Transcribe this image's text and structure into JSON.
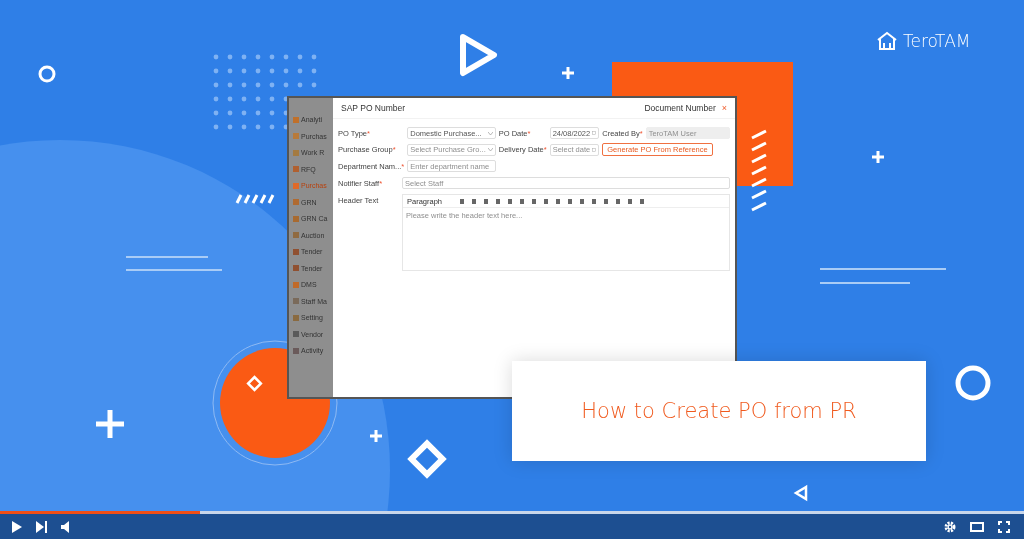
{
  "logo": {
    "name": "TeroTAM"
  },
  "app_window": {
    "title": "SAP PO Number",
    "document_label": "Document Number",
    "close": "×",
    "sidebar": [
      {
        "label": "Analyti",
        "selected": false
      },
      {
        "label": "Purchas",
        "selected": false
      },
      {
        "label": "Work R",
        "selected": false
      },
      {
        "label": "RFQ",
        "selected": false
      },
      {
        "label": "Purchas",
        "selected": true
      },
      {
        "label": "GRN",
        "selected": false
      },
      {
        "label": "GRN Ca",
        "selected": false
      },
      {
        "label": "Auction",
        "selected": false
      },
      {
        "label": "Tender",
        "selected": false
      },
      {
        "label": "Tender",
        "selected": false
      },
      {
        "label": "DMS",
        "selected": false
      },
      {
        "label": "Staff Ma",
        "selected": false
      },
      {
        "label": "Setting",
        "selected": false
      },
      {
        "label": "Vendor",
        "selected": false
      },
      {
        "label": "Activity",
        "selected": false
      }
    ],
    "form_rows": [
      [
        {
          "kind": "select",
          "label": "PO Type",
          "mark": "*",
          "text": "Domestic Purchase...",
          "filled": true,
          "disabled": false
        },
        {
          "kind": "date",
          "label": "PO Date",
          "mark": "*",
          "text": "24/08/2022",
          "filled": true,
          "disabled": false
        },
        {
          "kind": "text",
          "label": "Created By",
          "mark": "*",
          "text": "TeroTAM User",
          "filled": false,
          "disabled": true
        }
      ],
      [
        {
          "kind": "select",
          "label": "Purchase Group",
          "mark": "*",
          "text": "Select Purchase Gro...",
          "filled": false,
          "disabled": false
        },
        {
          "kind": "date",
          "label": "Delivery Date",
          "mark": "*",
          "text": "Select date",
          "filled": false,
          "disabled": false
        },
        {
          "kind": "button",
          "text": "Generate PO From Reference"
        }
      ],
      [
        {
          "kind": "text",
          "label": "Department Nam...",
          "mark": "*",
          "text": "Enter department name",
          "filled": false,
          "disabled": false
        }
      ]
    ],
    "notifier": {
      "label": "Notifier Staff",
      "mark": "*",
      "placeholder": "Select Staff"
    },
    "header_text": {
      "label": "Header Text",
      "format": "Paragraph",
      "placeholder": "Please write the header text here..."
    }
  },
  "title_card": {
    "text": "How to Create PO from PR"
  },
  "player": {
    "progress": {
      "level": 0.195
    }
  }
}
